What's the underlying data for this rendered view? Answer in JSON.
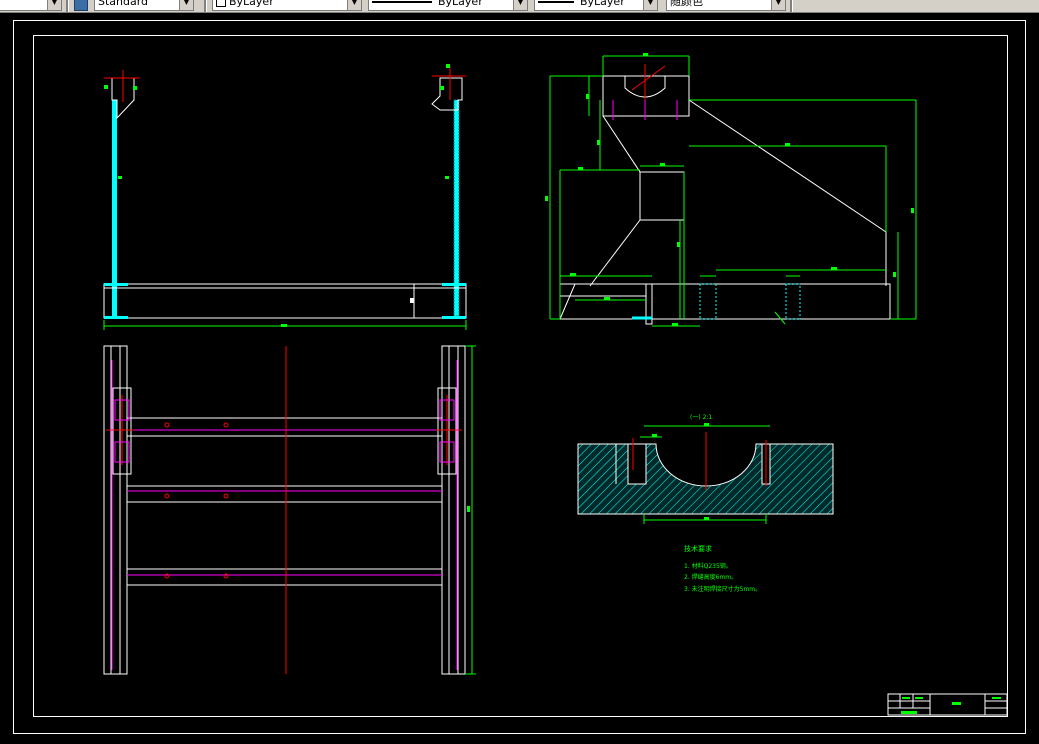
{
  "toolbar": {
    "text_style": "Standard",
    "layer_color": "ByLayer",
    "linetype": "ByLayer",
    "lineweight": "ByLayer",
    "plot_style": "随颜色"
  },
  "drawing": {
    "detail_label": "(一)  2:1",
    "notes_title": "技术要求",
    "notes": [
      "1. 材料Q235钢。",
      "2. 焊缝高度6mm。",
      "3. 未注明焊接尺寸为5mm。"
    ]
  },
  "colors": {
    "background": "#000000",
    "frame": "#ffffff",
    "dimension": "#00ff00",
    "steel": "#00ffff",
    "centerline": "#ff0000",
    "bolt": "#ff00ff"
  },
  "icons": [
    "text-style-icon",
    "combo-arrow-icon"
  ]
}
